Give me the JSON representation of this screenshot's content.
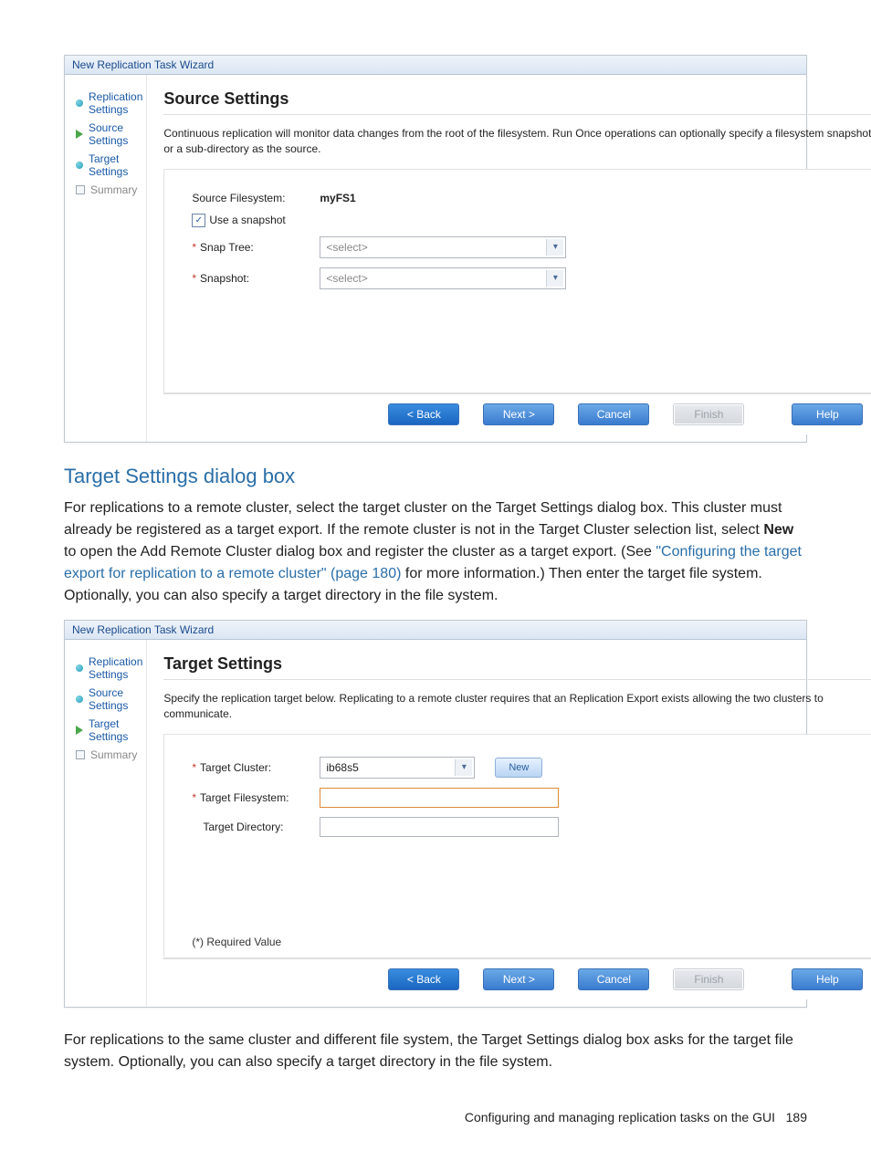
{
  "wizard1": {
    "title": "New Replication Task Wizard",
    "sidebar": [
      {
        "label": "Replication Settings",
        "icon": "dot"
      },
      {
        "label": "Source Settings",
        "icon": "arrow"
      },
      {
        "label": "Target Settings",
        "icon": "dot"
      },
      {
        "label": "Summary",
        "icon": "square",
        "muted": true
      }
    ],
    "heading": "Source Settings",
    "desc": "Continuous replication will monitor data changes from the root of the filesystem. Run Once operations can optionally specify a filesystem snapshot or a sub-directory as the source.",
    "source_fs_label": "Source Filesystem:",
    "source_fs_value": "myFS1",
    "use_snapshot_label": "Use a snapshot",
    "snap_tree_label": "Snap Tree:",
    "snapshot_label": "Snapshot:",
    "select_placeholder": "<select>",
    "buttons": {
      "back": "< Back",
      "next": "Next >",
      "cancel": "Cancel",
      "finish": "Finish",
      "help": "Help"
    }
  },
  "doc": {
    "h2": "Target Settings dialog box",
    "p1a": "For replications to a remote cluster, select the target cluster on the Target Settings dialog box. This cluster must already be registered as a target export. If the remote cluster is not in the Target Cluster selection list, select ",
    "p1_bold": "New",
    "p1b": " to open the Add Remote Cluster dialog box and register the cluster as a target export. (See ",
    "p1_link": "\"Configuring the target export for replication to a remote cluster\" (page 180)",
    "p1c": " for more information.) Then enter the target file system. Optionally, you can also specify a target directory in the file system.",
    "p2": "For replications to the same cluster and different file system, the Target Settings dialog box asks for the target file system. Optionally, you can also specify a target directory in the file system."
  },
  "wizard2": {
    "title": "New Replication Task Wizard",
    "sidebar": [
      {
        "label": "Replication Settings",
        "icon": "dot"
      },
      {
        "label": "Source Settings",
        "icon": "dot"
      },
      {
        "label": "Target Settings",
        "icon": "arrow"
      },
      {
        "label": "Summary",
        "icon": "square",
        "muted": true
      }
    ],
    "heading": "Target Settings",
    "desc": "Specify the replication target below. Replicating to a remote cluster requires that an Replication Export exists allowing the two clusters to communicate.",
    "target_cluster_label": "Target Cluster:",
    "target_cluster_value": "ib68s5",
    "new_btn": "New",
    "target_fs_label": "Target Filesystem:",
    "target_dir_label": "Target Directory:",
    "required_note": "(*) Required Value",
    "buttons": {
      "back": "< Back",
      "next": "Next >",
      "cancel": "Cancel",
      "finish": "Finish",
      "help": "Help"
    }
  },
  "footer": {
    "text": "Configuring and managing replication tasks on the GUI",
    "page": "189"
  }
}
